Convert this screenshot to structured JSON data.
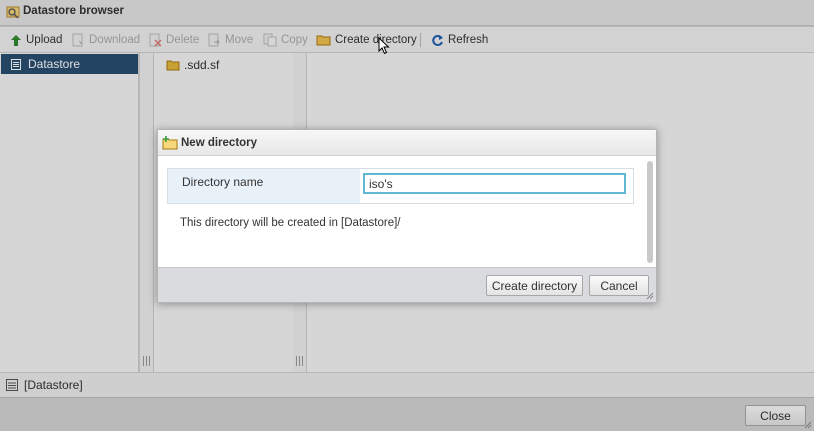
{
  "window": {
    "title": "Datastore browser"
  },
  "toolbar": {
    "upload": "Upload",
    "download": "Download",
    "delete": "Delete",
    "move": "Move",
    "copy": "Copy",
    "create_directory": "Create directory",
    "refresh": "Refresh"
  },
  "tree": {
    "selected": "Datastore"
  },
  "files": [
    {
      "name": ".sdd.sf"
    }
  ],
  "status": {
    "path": "[Datastore]"
  },
  "footer": {
    "close_label": "Close"
  },
  "dialog": {
    "title": "New directory",
    "field_label": "Directory name",
    "field_value": "iso's",
    "note": "This directory will be created in [Datastore]/",
    "create_label": "Create directory",
    "cancel_label": "Cancel"
  },
  "colors": {
    "selection": "#2a4e72",
    "input_focus": "#61b7d6",
    "refresh_icon": "#1f5fb0",
    "upload_icon": "#2e8b2e"
  }
}
